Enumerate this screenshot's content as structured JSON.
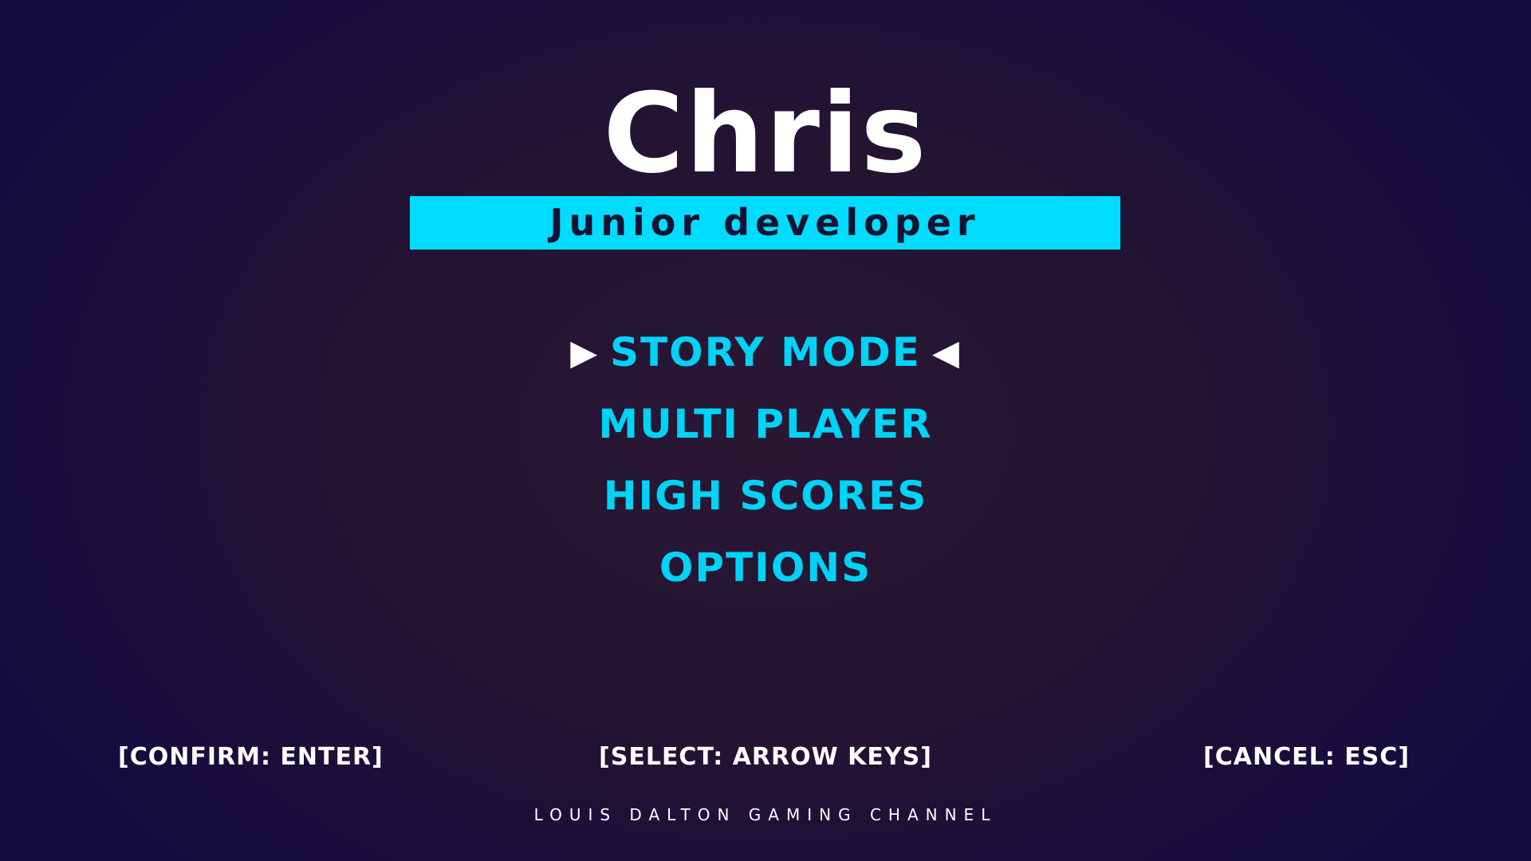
{
  "title": "Chris",
  "subtitle": "Junior developer",
  "menu": {
    "items": [
      {
        "label": "STORY MODE",
        "selected": true
      },
      {
        "label": "MULTI PLAYER",
        "selected": false
      },
      {
        "label": "HIGH SCORES",
        "selected": false
      },
      {
        "label": "OPTIONS",
        "selected": false
      }
    ],
    "selector_left": "▶",
    "selector_right": "◀"
  },
  "hints": {
    "confirm": "[CONFIRM: ENTER]",
    "select": "[SELECT: ARROW KEYS]",
    "cancel": "[CANCEL: ESC]"
  },
  "footer": "LOUIS DALTON GAMING CHANNEL",
  "colors": {
    "accent": "#00dcff",
    "menu_text": "#00d3f6",
    "background": "#221432"
  }
}
